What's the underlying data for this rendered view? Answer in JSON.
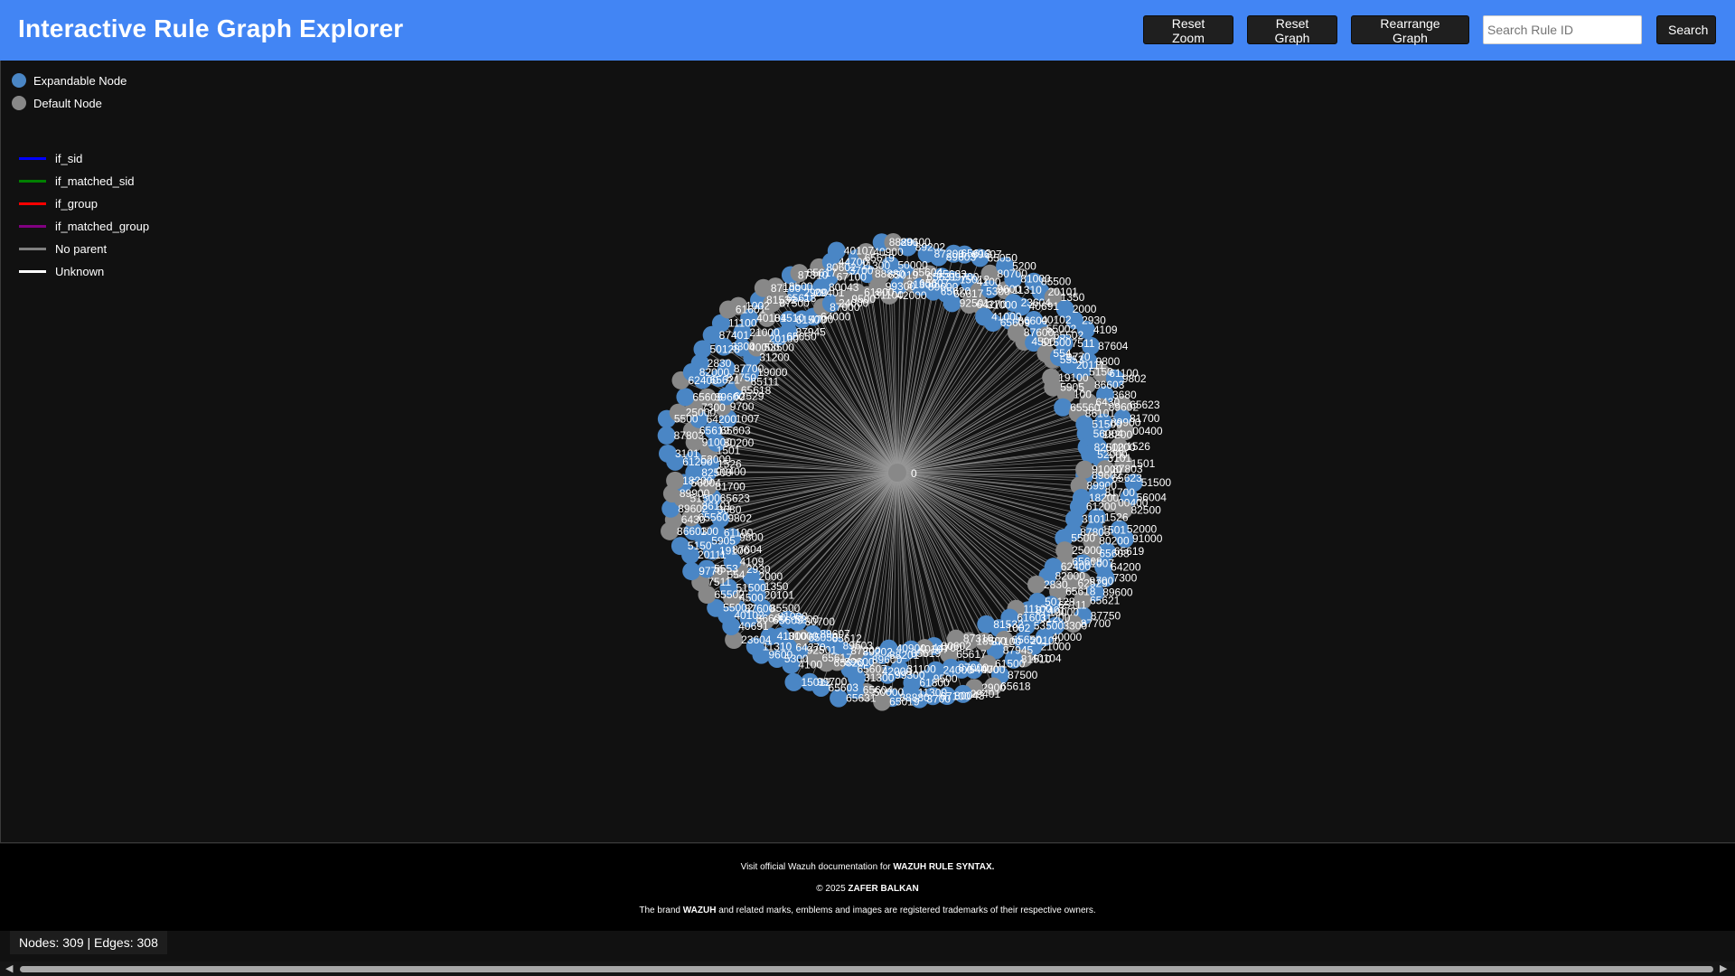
{
  "header": {
    "title": "Interactive Rule Graph Explorer",
    "buttons": {
      "reset_zoom": "Reset Zoom",
      "reset_graph": "Reset Graph",
      "rearrange_graph": "Rearrange Graph",
      "search": "Search"
    },
    "search_placeholder": "Search Rule ID",
    "search_value": ""
  },
  "legend": {
    "node_types": [
      {
        "label": "Expandable Node",
        "color": "#4a86c5"
      },
      {
        "label": "Default Node",
        "color": "#888888"
      }
    ],
    "edge_types": [
      {
        "label": "if_sid",
        "color": "#0000ff"
      },
      {
        "label": "if_matched_sid",
        "color": "#008000"
      },
      {
        "label": "if_group",
        "color": "#ff0000"
      },
      {
        "label": "if_matched_group",
        "color": "#800080"
      },
      {
        "label": "No parent",
        "color": "#808080"
      },
      {
        "label": "Unknown",
        "color": "#ffffff"
      }
    ]
  },
  "graph": {
    "root_label": "0",
    "node_labels": [
      "89602",
      "65623",
      "51500",
      "89900",
      "81700",
      "56004",
      "18200",
      "00400",
      "82500",
      "61200",
      "1526",
      "52000",
      "3101",
      "1501",
      "91000",
      "87803",
      "80200",
      "65619",
      "5500",
      "65603",
      "64200",
      "25000",
      "1007",
      "7300",
      "65608",
      "9700",
      "89600",
      "62400",
      "62529",
      "65621",
      "82000",
      "65618",
      "87750",
      "2830",
      "65111",
      "87700",
      "50128",
      "19000",
      "3300",
      "87401",
      "31200",
      "40000",
      "11100",
      "53500",
      "21000",
      "61601",
      "20100",
      "40104",
      "1002",
      "65650",
      "81510",
      "81532",
      "87945",
      "87500",
      "87100",
      "61500",
      "65618",
      "18500",
      "4700",
      "2900",
      "87310",
      "64000",
      "29401",
      "65617",
      "87000",
      "80043",
      "80602",
      "24000",
      "67100",
      "44700",
      "9500",
      "3700",
      "40107",
      "61800",
      "11300",
      "65619",
      "31100",
      "88880",
      "40900",
      "99300",
      "65019",
      "88201",
      "42000",
      "50000",
      "89600",
      "31300",
      "65604",
      "89202",
      "65607",
      "65631",
      "87200",
      "89600",
      "65603",
      "89603",
      "65620",
      "99700",
      "65612",
      "65617",
      "15012",
      "89607",
      "92501",
      "4100",
      "65050",
      "64270",
      "5300",
      "80700",
      "31000",
      "9600",
      "5200",
      "41000",
      "11310",
      "81000",
      "65609",
      "23604",
      "85500",
      "86600",
      "40691",
      "20101",
      "87600",
      "40102",
      "1350",
      "4500",
      "55002",
      "2000",
      "51500",
      "65502",
      "2930",
      "554",
      "7511",
      "4109",
      "5553",
      "9770",
      "87604",
      "19100",
      "20111",
      "9800",
      "5905",
      "5150",
      "61100",
      "100",
      "86603",
      "9802",
      "65560",
      "6430",
      "3680",
      "86101"
    ],
    "expandable_ratio": 0.62
  },
  "footer": {
    "doc_prefix": "Visit official Wazuh documentation for ",
    "doc_link": "WAZUH RULE SYNTAX.",
    "copyright_prefix": "© 2025 ",
    "copyright_name": "ZAFER BALKAN",
    "trademark_prefix": "The brand ",
    "trademark_brand": "WAZUH",
    "trademark_suffix": " and related marks, emblems and images are registered trademarks of their respective owners."
  },
  "stats": {
    "text": "Nodes: 309 | Edges: 308"
  },
  "colors": {
    "header_bg": "#4285f4",
    "page_bg": "#111111",
    "expandable_node": "#4a86c5",
    "default_node": "#888888",
    "edge": "#9a9a9a"
  },
  "icons": {
    "scroll_left": "triangle-left-icon",
    "scroll_right": "triangle-right-icon"
  }
}
